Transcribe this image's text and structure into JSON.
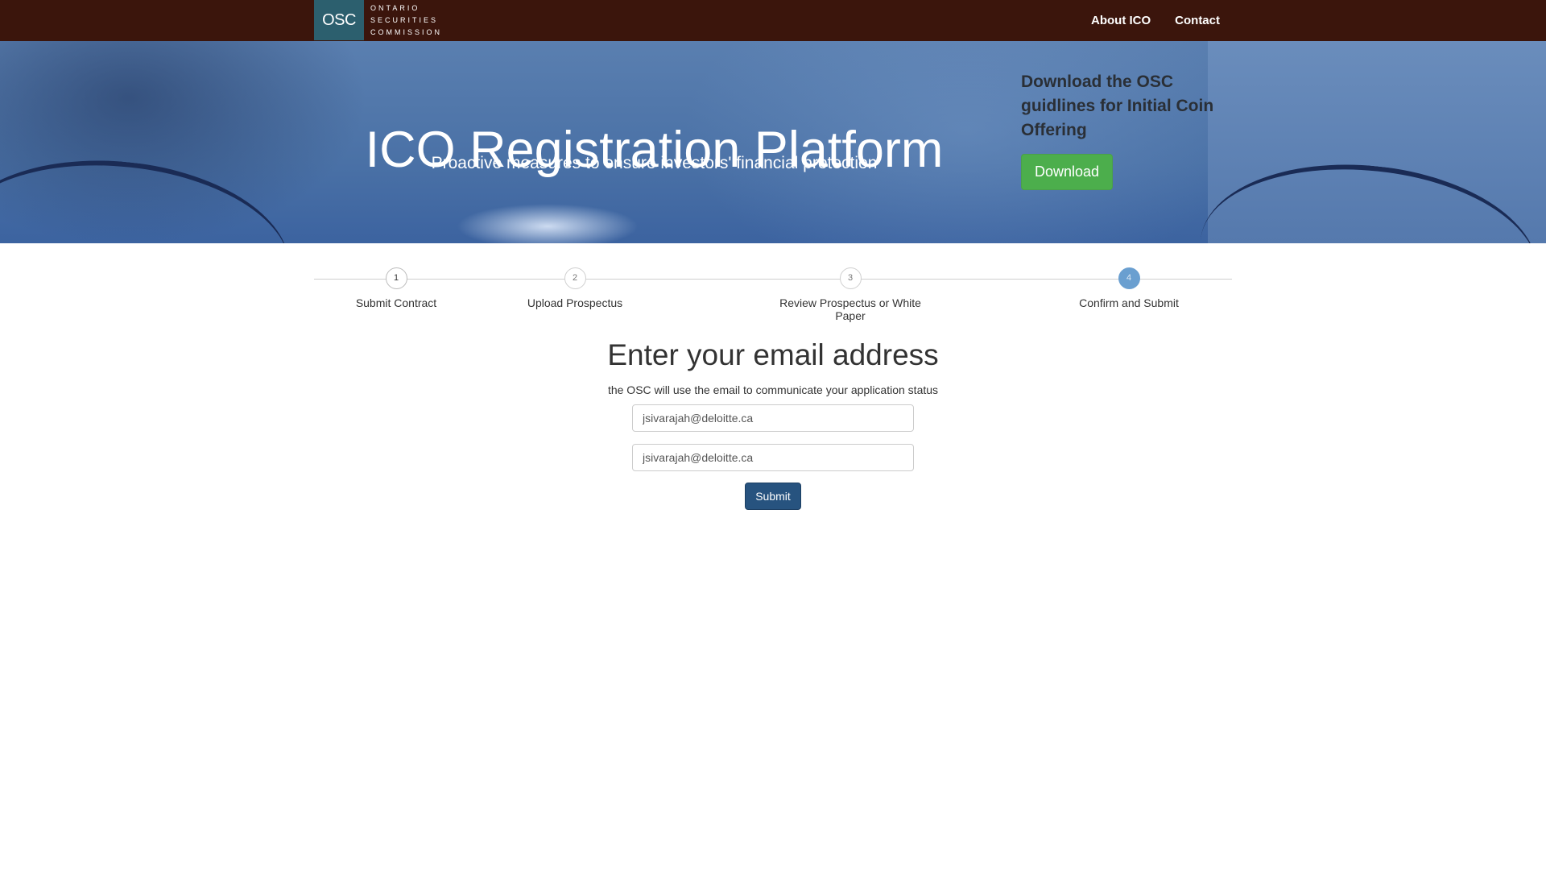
{
  "navbar": {
    "logo_abbr": "OSC",
    "logo_line1": "ONTARIO",
    "logo_line2": "SECURITIES",
    "logo_line3": "COMMISSION",
    "links": [
      {
        "label": "About ICO"
      },
      {
        "label": "Contact"
      }
    ]
  },
  "hero": {
    "title": "ICO Registration Platform",
    "subtitle": "Proactive measures to ensure investors' financial protection",
    "download_heading": "Download the OSC guidlines for Initial Coin Offering",
    "download_button": "Download"
  },
  "steps": [
    {
      "number": "1",
      "label": "Submit Contract",
      "state": "complete"
    },
    {
      "number": "2",
      "label": "Upload Prospectus",
      "state": "pending"
    },
    {
      "number": "3",
      "label": "Review Prospectus or White Paper",
      "state": "pending"
    },
    {
      "number": "4",
      "label": "Confirm and Submit",
      "state": "active"
    }
  ],
  "form": {
    "title": "Enter your email address",
    "description": "the OSC will use the email to communicate your application status",
    "email_value": "jsivarajah@deloitte.ca",
    "confirm_email_value": "jsivarajah@deloitte.ca",
    "submit_label": "Submit"
  },
  "colors": {
    "navbar_bg": "#3b150c",
    "download_button": "#4cae4c",
    "submit_button": "#27537f",
    "active_step": "#6a9fd0"
  }
}
